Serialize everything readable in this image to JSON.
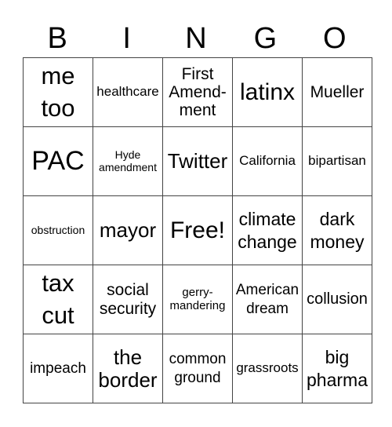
{
  "header": {
    "letters": [
      "B",
      "I",
      "N",
      "G",
      "O"
    ]
  },
  "board": {
    "rows": [
      [
        "me\ntoo",
        "healthcare",
        "First\nAmend-\nment",
        "latinx",
        "Mueller"
      ],
      [
        "PAC",
        "Hyde\namendment",
        "Twitter",
        "California",
        "bipartisan"
      ],
      [
        "obstruction",
        "mayor",
        "Free!",
        "climate\nchange",
        "dark\nmoney"
      ],
      [
        "tax\ncut",
        "social\nsecurity",
        "gerry-\nmandering",
        "American\ndream",
        "collusion"
      ],
      [
        "impeach",
        "the\nborder",
        "common\nground",
        "grassroots",
        "big\npharma"
      ]
    ]
  }
}
